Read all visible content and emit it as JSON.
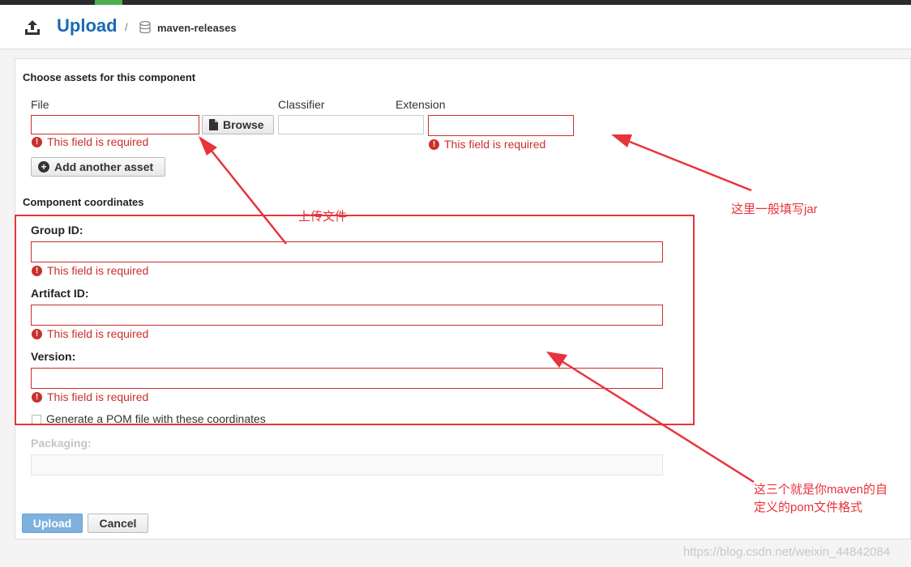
{
  "header": {
    "title": "Upload",
    "separator": "/",
    "repository": "maven-releases"
  },
  "assets": {
    "section_title": "Choose assets for this component",
    "file_label": "File",
    "browse_label": "Browse",
    "classifier_label": "Classifier",
    "extension_label": "Extension",
    "file_error": "This field is required",
    "extension_error": "This field is required",
    "add_asset_label": "Add another asset"
  },
  "coordinates": {
    "section_title": "Component coordinates",
    "group_label": "Group ID:",
    "group_error": "This field is required",
    "artifact_label": "Artifact ID:",
    "artifact_error": "This field is required",
    "version_label": "Version:",
    "version_error": "This field is required",
    "pom_label": "Generate a POM file with these coordinates",
    "packaging_label": "Packaging:"
  },
  "actions": {
    "upload_label": "Upload",
    "cancel_label": "Cancel"
  },
  "annotations": {
    "upload_file": "上传文件",
    "extension_hint": "这里一般填写jar",
    "coordinates_hint_line1": "这三个就是你maven的自",
    "coordinates_hint_line2": "定义的pom文件格式"
  },
  "watermark": "https://blog.csdn.net/weixin_44842084",
  "colors": {
    "accent": "#1a6ab2",
    "error": "#c9302c",
    "annotation": "#e8333a",
    "primary_button": "#7fb1de"
  }
}
